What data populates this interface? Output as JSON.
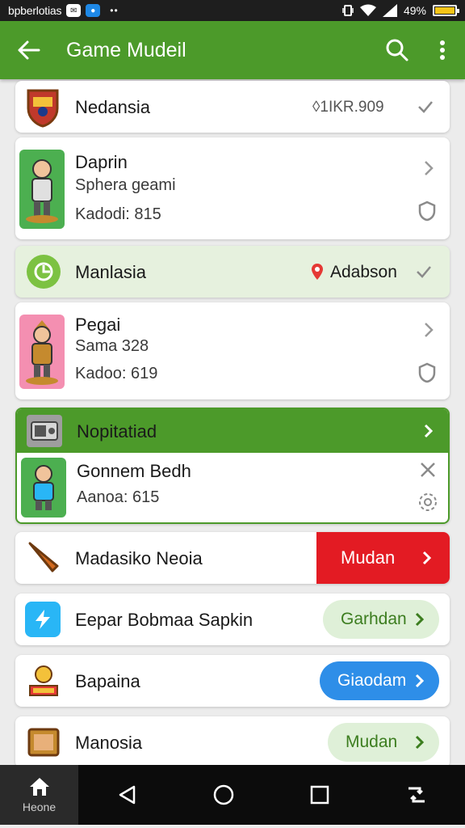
{
  "status_bar": {
    "app_text": "bpberlotias",
    "badge_1": "✉",
    "badge_2": "●",
    "dots": "••",
    "battery_text": "49%",
    "battery_level_percent": 90
  },
  "app_bar": {
    "title": "Game Mudeil",
    "back_icon": "arrow-left-icon",
    "search_icon": "search-icon",
    "menu_icon": "more-vert-icon",
    "color": "#4c9a2a"
  },
  "items": [
    {
      "title": "Nedansia",
      "trailing_text": "◊1IKR.909",
      "trailing_icon": "check-icon"
    },
    {
      "title": "Daprin",
      "subtitle": "Sphera geami",
      "detail": "Kadodi: 815",
      "trailing_icon": "chevron-right-icon",
      "secondary_icon": "shield-icon"
    },
    {
      "title": "Manlasia",
      "location": "Adabson",
      "trailing_icon": "check-icon",
      "background": "#e6f1de"
    },
    {
      "title": "Pegai",
      "subtitle": "Sama 328",
      "detail": "Kadoo: 619",
      "trailing_icon": "chevron-right-icon",
      "secondary_icon": "shield-icon"
    },
    {
      "header_title": "Nopitatiad",
      "title": "Gonnem Bedh",
      "detail": "Aanoa: 615",
      "header_color": "#4c9a2a",
      "close_icon": "close-icon",
      "settings_icon": "gear-icon"
    },
    {
      "title": "Madasiko Neoia",
      "button_label": "Mudan",
      "button_color": "#e31b23"
    },
    {
      "title": "Eepar Bobmaa Sapkin",
      "button_label": "Garhdan",
      "button_color": "#dff0d8"
    },
    {
      "title": "Bapaina",
      "button_label": "Giaodam",
      "button_color": "#2e8ee8"
    },
    {
      "title": "Manosia",
      "button_label": "Mudan",
      "button_color": "#dff0d8"
    }
  ],
  "nav_bar": {
    "home_label": "Heone",
    "back_icon": "triangle-back-icon",
    "home_icon": "circle-home-icon",
    "recents_icon": "square-recents-icon",
    "extra_icon": "rotate-icon"
  }
}
